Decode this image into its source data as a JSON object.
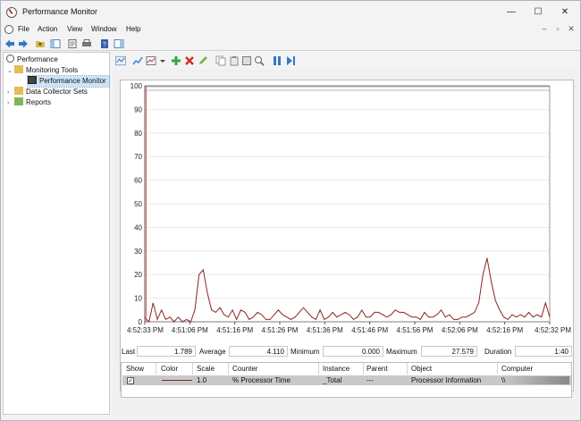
{
  "window": {
    "title": "Performance Monitor"
  },
  "menu": {
    "items": [
      "File",
      "Action",
      "View",
      "Window",
      "Help"
    ]
  },
  "window_controls": [
    "minimize-icon",
    "maximize-icon",
    "close-icon"
  ],
  "tree": {
    "root": "Performance",
    "monitoring_tools": "Monitoring Tools",
    "performance_monitor": "Performance Monitor",
    "data_collector_sets": "Data Collector Sets",
    "reports": "Reports"
  },
  "chart_data": {
    "type": "line",
    "ylim": [
      0,
      100
    ],
    "yticks": [
      0,
      10,
      20,
      30,
      40,
      50,
      60,
      70,
      80,
      90,
      100
    ],
    "xticks": [
      "4:52:33 PM",
      "4:51:06 PM",
      "4:51:16 PM",
      "4:51:26 PM",
      "4:51:36 PM",
      "4:51:46 PM",
      "4:51:56 PM",
      "4:52:06 PM",
      "4:52:16 PM",
      "4:52:32 PM"
    ],
    "series": [
      {
        "color": "#8b2323",
        "values": [
          1.8,
          0,
          8,
          1,
          5,
          1,
          2,
          0,
          2,
          0,
          1,
          0,
          5,
          20,
          22,
          12,
          5,
          4,
          6,
          3,
          2,
          5,
          1,
          5,
          4,
          1,
          2,
          4,
          3,
          1,
          1,
          3,
          5,
          3,
          2,
          1,
          2,
          4,
          6,
          4,
          2,
          1,
          5,
          1,
          2,
          4,
          2,
          3,
          4,
          3,
          1,
          2,
          5,
          2,
          2,
          4,
          4,
          3,
          2,
          3,
          5,
          4,
          4,
          3,
          2,
          2,
          1,
          4,
          2,
          2,
          3,
          5,
          2,
          3,
          1,
          1,
          2,
          2,
          3,
          4,
          8,
          20,
          27,
          17,
          9,
          5,
          2,
          1,
          3,
          2,
          3,
          2,
          4,
          2,
          3,
          2,
          8,
          2
        ]
      }
    ]
  },
  "stats": {
    "last_label": "Last",
    "last_value": "1.789",
    "average_label": "Average",
    "average_value": "4.110",
    "minimum_label": "Minimum",
    "minimum_value": "0.000",
    "maximum_label": "Maximum",
    "maximum_value": "27.579",
    "duration_label": "Duration",
    "duration_value": "1:40"
  },
  "counter_table": {
    "headers": [
      "Show",
      "Color",
      "Scale",
      "Counter",
      "Instance",
      "Parent",
      "Object",
      "Computer"
    ],
    "rows": [
      {
        "show": "✓",
        "scale": "1.0",
        "counter": "% Processor Time",
        "instance": "_Total",
        "parent": "---",
        "object": "Processor Information",
        "computer": "\\\\"
      }
    ]
  }
}
